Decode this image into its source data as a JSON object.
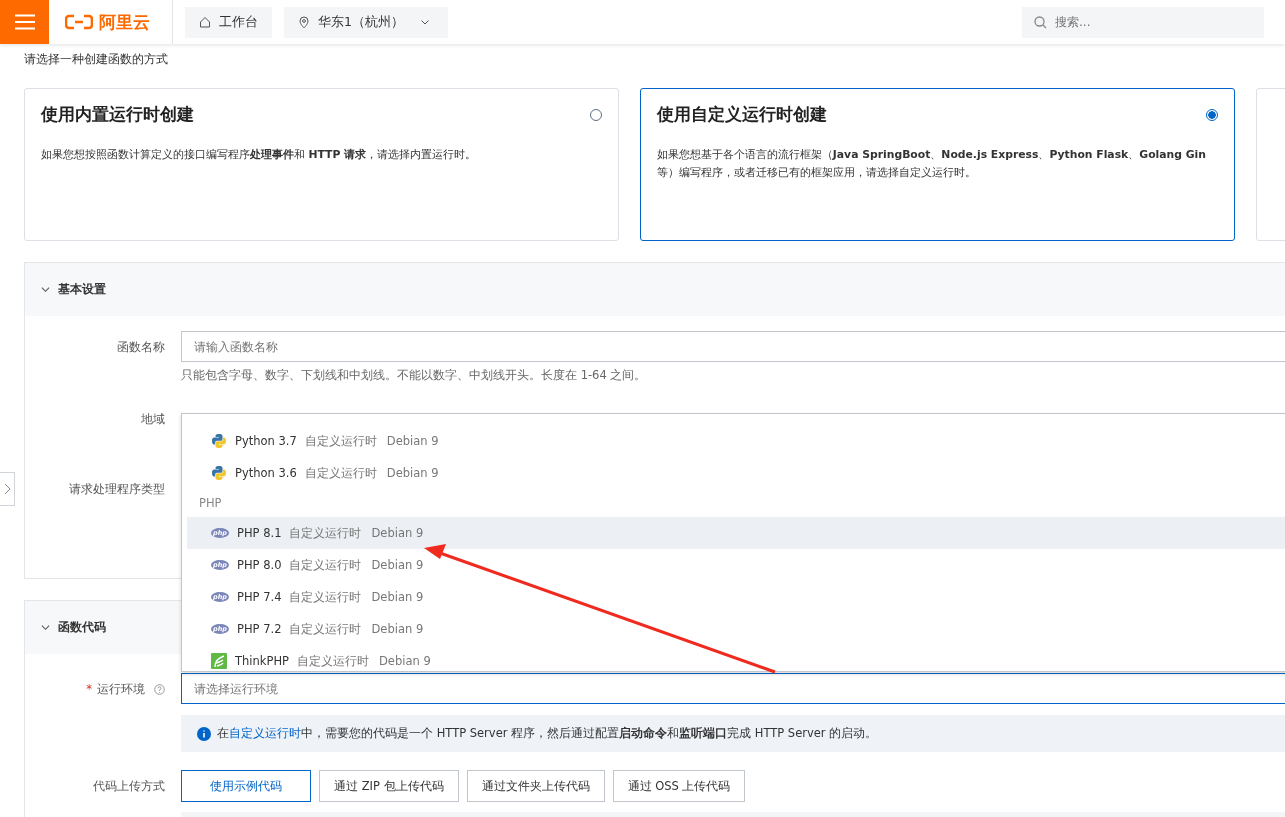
{
  "header": {
    "logo": "阿里云",
    "workbench": "工作台",
    "region": "华东1（杭州）",
    "search": {
      "placeholder": "搜索..."
    }
  },
  "intro": "请选择一种创建函数的方式",
  "cards": [
    {
      "title": "使用内置运行时创建",
      "description": "如果您想按照函数计算定义的接口编写程序**处理事件**和 **HTTP 请求**，请选择内置运行时。",
      "selected": false
    },
    {
      "title": "使用自定义运行时创建",
      "description": "如果您想基于各个语言的流行框架（**Java SpringBoot**、**Node.js Express**、**Python Flask**、**Golang Gin** 等）编写程序，或者迁移已有的框架应用，请选择自定义运行时。",
      "selected": true
    }
  ],
  "basic_settings": {
    "title": "基本设置",
    "expanded": true,
    "name_label": "函数名称",
    "name_field": {
      "placeholder": "请输入函数名称"
    },
    "name_help": "只能包含字母、数字、下划线和中划线。不能以数字、中划线开头。长度在 1-64 之间。",
    "region_label": "地域",
    "handler_type_label": "请求处理程序类型"
  },
  "function_code": {
    "title": "函数代码",
    "expanded": true,
    "runtime_label": "运行环境",
    "runtime_required": true,
    "runtime_field": {
      "placeholder": "请选择运行环境"
    },
    "notice": {
      "before": "在",
      "link": "自定义运行时",
      "after": "中，需要您的代码是一个 HTTP Server 程序，然后通过配置**启动命令**和**监听端口**完成 HTTP Server 的启动。"
    },
    "required_mark": "*",
    "upload_label": "代码上传方式",
    "upload_options": [
      {
        "label": "使用示例代码",
        "selected": true
      },
      {
        "label": "通过 ZIP 包上传代码",
        "selected": false
      },
      {
        "label": "通过文件夹上传代码",
        "selected": false
      },
      {
        "label": "通过 OSS 上传代码",
        "selected": false
      }
    ]
  },
  "runtime_dropdown": [
    {
      "kind": "python",
      "name": "Python 3.7",
      "runtime": "自定义运行时",
      "os": "Debian 9",
      "highlighted": false
    },
    {
      "kind": "python",
      "name": "Python 3.6",
      "runtime": "自定义运行时",
      "os": "Debian 9",
      "highlighted": false
    },
    {
      "kind": "group",
      "name": "PHP"
    },
    {
      "kind": "php",
      "name": "PHP 8.1",
      "runtime": "自定义运行时",
      "os": "Debian 9",
      "highlighted": true
    },
    {
      "kind": "php",
      "name": "PHP 8.0",
      "runtime": "自定义运行时",
      "os": "Debian 9",
      "highlighted": false
    },
    {
      "kind": "php",
      "name": "PHP 7.4",
      "runtime": "自定义运行时",
      "os": "Debian 9",
      "highlighted": false
    },
    {
      "kind": "php",
      "name": "PHP 7.2",
      "runtime": "自定义运行时",
      "os": "Debian 9",
      "highlighted": false
    },
    {
      "kind": "thinkphp",
      "name": "ThinkPHP",
      "runtime": "自定义运行时",
      "os": "Debian 9",
      "highlighted": false
    }
  ]
}
